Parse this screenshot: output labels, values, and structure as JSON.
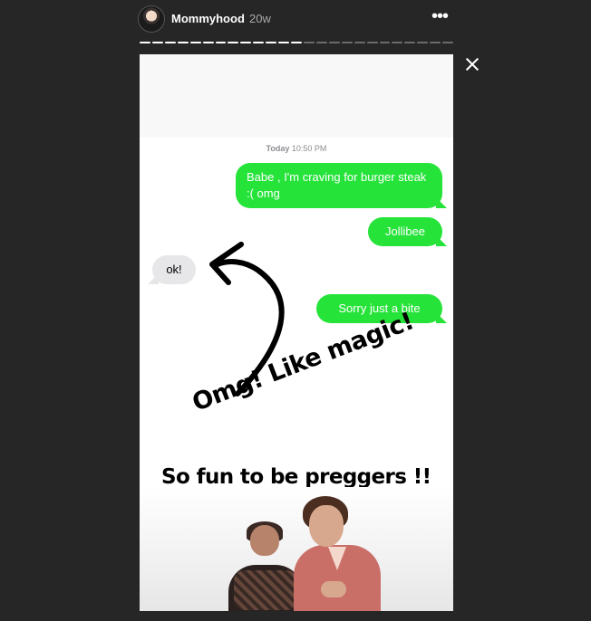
{
  "header": {
    "username": "Mommyhood",
    "time_ago": "20w",
    "more_label": "•••"
  },
  "progress": {
    "segments": 25,
    "completed": 13
  },
  "story": {
    "timestamp_day": "Today",
    "timestamp_time": "10:50 PM",
    "messages": [
      {
        "text": "Babe , I'm craving for burger steak :( omg",
        "sender": "me"
      },
      {
        "text": "Jollibee",
        "sender": "me"
      },
      {
        "text": "ok!",
        "sender": "them"
      },
      {
        "text": "Sorry just a bite",
        "sender": "me"
      }
    ],
    "caption_magic": "Omg! Like magic!",
    "caption_preggers": "So fun to be preggers !!"
  },
  "colors": {
    "background": "#262626",
    "bubble_out": "#26e33a",
    "bubble_in": "#e7e7ea"
  },
  "icons": {
    "close": "close-icon",
    "more": "more-options-icon",
    "arrow": "hand-drawn-arrow-icon"
  }
}
